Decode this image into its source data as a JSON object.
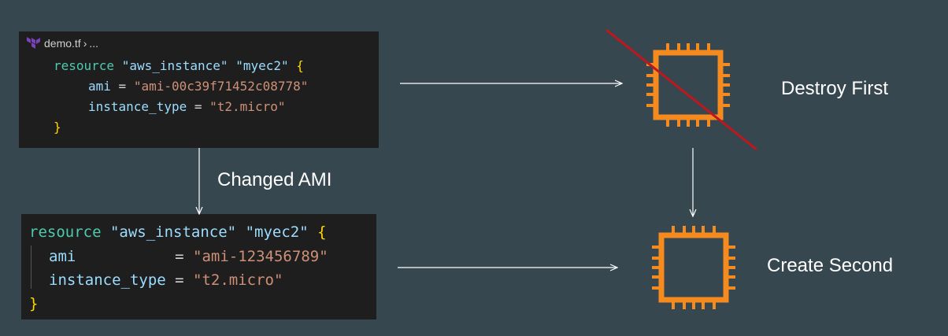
{
  "block1": {
    "tab": {
      "filename": "demo.tf",
      "chevron": "›",
      "ellipsis": "..."
    },
    "resource_kw": "resource",
    "resource_type": "\"aws_instance\"",
    "resource_name": "\"myec2\"",
    "open_brace": "{",
    "ami_key": "ami",
    "ami_eq": " = ",
    "ami_value": "\"ami-00c39f71452c08778\"",
    "type_key": "instance_type",
    "type_eq": " = ",
    "type_value": "\"t2.micro\"",
    "close_brace": "}"
  },
  "block2": {
    "resource_kw": "resource",
    "resource_type": "\"aws_instance\"",
    "resource_name": "\"myec2\"",
    "open_brace": "{",
    "ami_key": "ami",
    "ami_eq": "           = ",
    "ami_value": "\"ami-123456789\"",
    "type_key": "instance_type",
    "type_eq": " = ",
    "type_value": "\"t2.micro\"",
    "close_brace": "}"
  },
  "labels": {
    "changed": "Changed AMI",
    "destroy": "Destroy First",
    "create": "Create Second"
  },
  "colors": {
    "chip": "#f58a1f",
    "strike": "#c0161d",
    "background": "#37474f"
  }
}
